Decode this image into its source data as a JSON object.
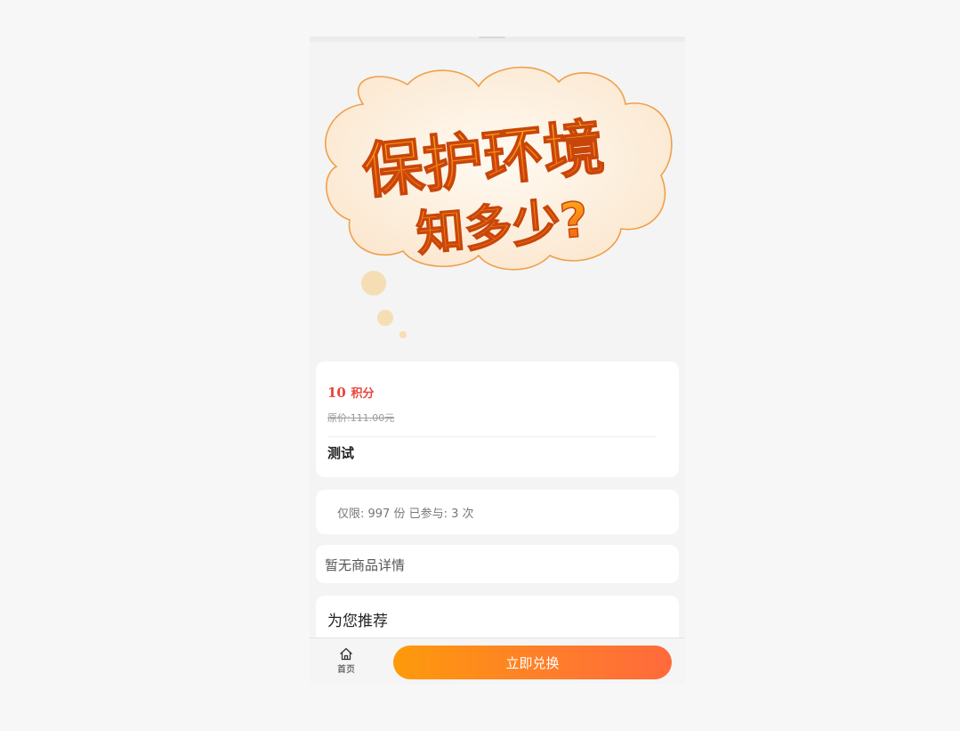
{
  "banner": {
    "line1": "保护环境",
    "line2": "知多少?",
    "colors": {
      "cloud_fill": "#fdf3e3",
      "cloud_stroke": "#f0a04a",
      "text_top": "#ffb21a",
      "text_bottom": "#f25a12"
    }
  },
  "product": {
    "points_value": "10",
    "points_unit": "积分",
    "original_price": "原价:111.00元",
    "name": "测试",
    "price_color": "#e8463a"
  },
  "stock": {
    "text": "仅限: 997 份 已参与: 3 次"
  },
  "detail": {
    "text": "暂无商品详情"
  },
  "recommend": {
    "title": "为您推荐"
  },
  "tabbar": {
    "home_icon": "home-icon",
    "home_label": "首页",
    "exchange_label": "立即兑换",
    "exchange_gradient": [
      "#fd9a0b",
      "#ff6a3b"
    ]
  }
}
